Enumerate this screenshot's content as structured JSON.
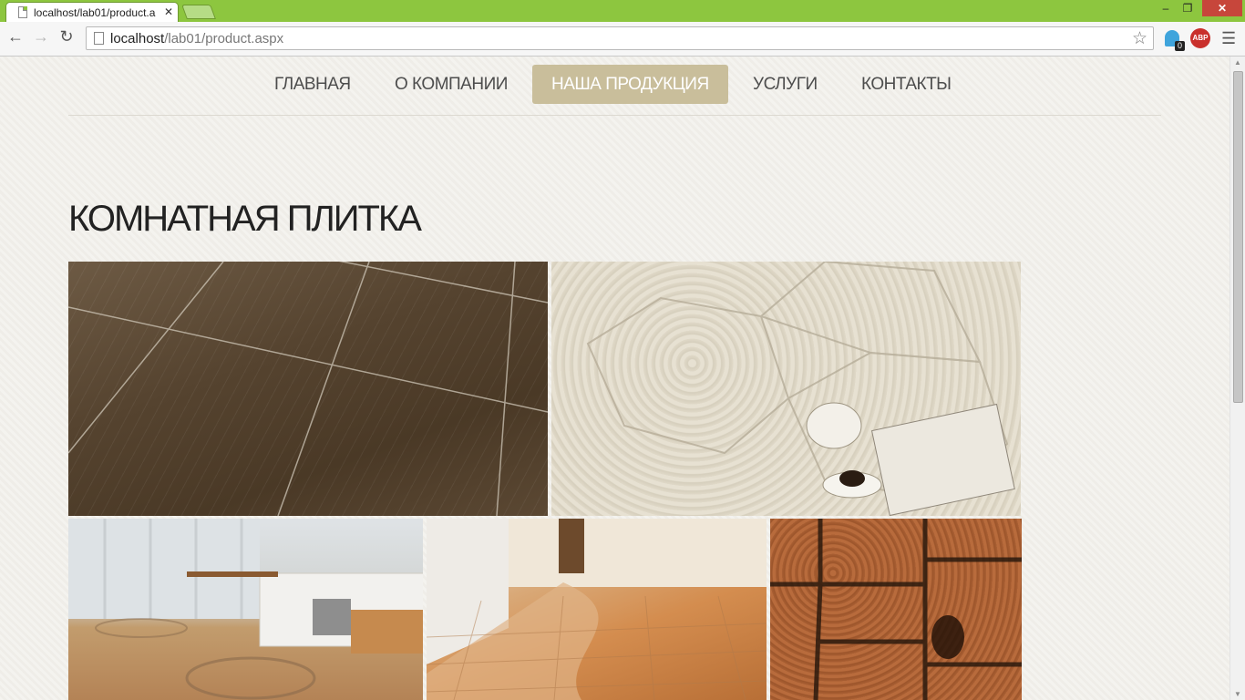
{
  "browser": {
    "tab_title": "localhost/lab01/product.a",
    "tab_close": "✕",
    "url_host": "localhost",
    "url_path": "/lab01/product.aspx",
    "ghost_badge": "0",
    "abp_label": "ABP",
    "window_minimize": "–",
    "window_restore": "❐",
    "window_close": "✕",
    "back": "←",
    "forward": "→",
    "reload": "↻",
    "star": "☆",
    "menu": "☰"
  },
  "nav": {
    "items": [
      {
        "label": "ГЛАВНАЯ",
        "active": false
      },
      {
        "label": "О КОМПАНИИ",
        "active": false
      },
      {
        "label": "НАША ПРОДУКЦИЯ",
        "active": true
      },
      {
        "label": "УСЛУГИ",
        "active": false
      },
      {
        "label": "КОНТАКТЫ",
        "active": false
      }
    ]
  },
  "page": {
    "title": "КОМНАТНАЯ ПЛИТКА"
  },
  "gallery": [
    {
      "name": "wood-plank-tile-photo"
    },
    {
      "name": "hexagon-relief-tile-photo"
    },
    {
      "name": "kitchen-mosaic-floor-photo"
    },
    {
      "name": "terracotta-floor-photo"
    },
    {
      "name": "end-grain-wood-tile-photo"
    }
  ],
  "colors": {
    "chrome_frame": "#8dc63f",
    "nav_active_bg": "#c9be9b",
    "page_bg": "#f3f2ee",
    "title_text": "#222222"
  }
}
